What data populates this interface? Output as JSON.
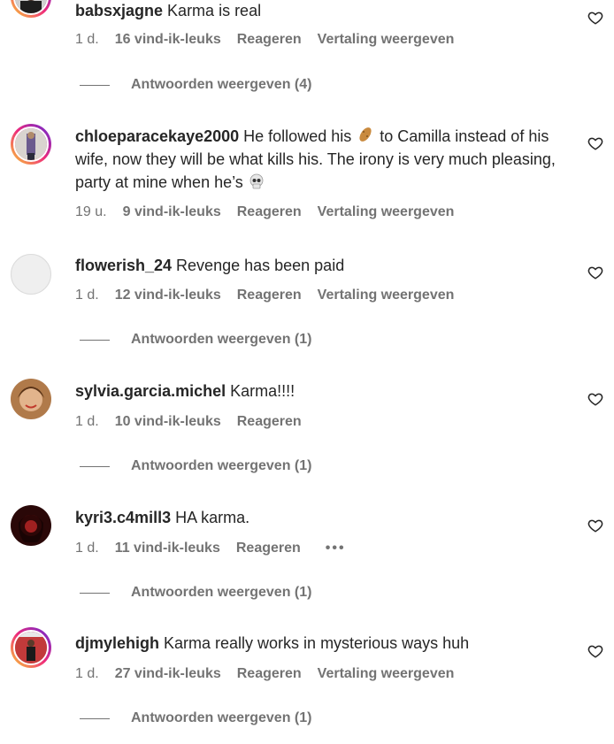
{
  "icons": {
    "heart": "heart-outline-icon",
    "peanut": "peanut-emoji",
    "skull": "skull-emoji",
    "more": "more-options-icon"
  },
  "colors": {
    "text": "#262626",
    "secondary": "#737373",
    "story_ring": [
      "#f9ce34",
      "#ee2a7b",
      "#6228d7"
    ]
  },
  "comments": [
    {
      "username": "babsxjagne",
      "text": " Karma is real",
      "time": "1 d.",
      "likes": "16 vind-ik-leuks",
      "reply": "Reageren",
      "translate": "Vertaling weergeven",
      "replies": "Antwoorden weergeven (4)"
    },
    {
      "username": "chloeparacekaye2000",
      "text_part1": " He followed his ",
      "text_part2": " to Camilla instead of his wife, now they will be what kills his. The irony is very much pleasing, party at mine when he’s ",
      "time": "19 u.",
      "likes": "9 vind-ik-leuks",
      "reply": "Reageren",
      "translate": "Vertaling weergeven"
    },
    {
      "username": "flowerish_24",
      "text": " Revenge has been paid",
      "time": "1 d.",
      "likes": "12 vind-ik-leuks",
      "reply": "Reageren",
      "translate": "Vertaling weergeven",
      "replies": "Antwoorden weergeven (1)"
    },
    {
      "username": "sylvia.garcia.michel",
      "text": " Karma!!!!",
      "time": "1 d.",
      "likes": "10 vind-ik-leuks",
      "reply": "Reageren",
      "replies": "Antwoorden weergeven (1)"
    },
    {
      "username": "kyri3.c4mill3",
      "text": " HA karma.",
      "time": "1 d.",
      "likes": "11 vind-ik-leuks",
      "reply": "Reageren",
      "more": "•••",
      "replies": "Antwoorden weergeven (1)"
    },
    {
      "username": "djmylehigh",
      "text": " Karma really works in mysterious ways huh",
      "time": "1 d.",
      "likes": "27 vind-ik-leuks",
      "reply": "Reageren",
      "translate": "Vertaling weergeven",
      "replies": "Antwoorden weergeven (1)"
    }
  ]
}
